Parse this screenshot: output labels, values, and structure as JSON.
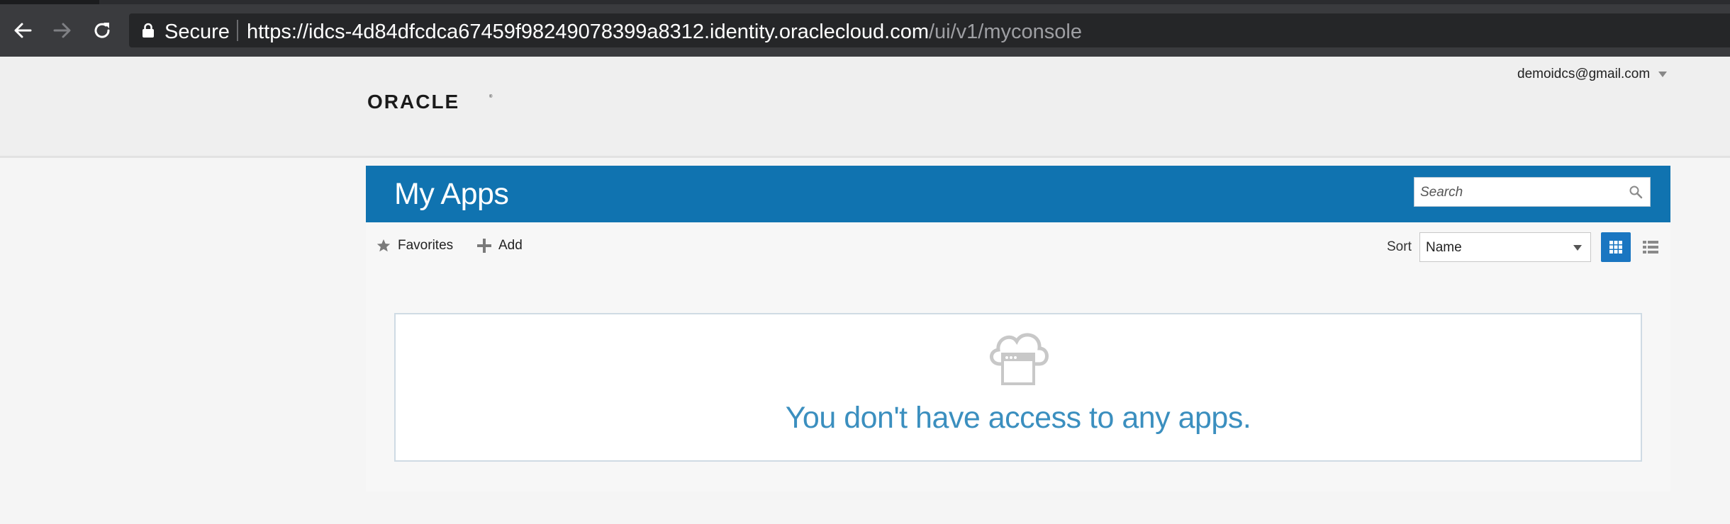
{
  "browser": {
    "back_icon": "arrow-left-icon",
    "forward_icon": "arrow-right-icon",
    "reload_icon": "reload-icon",
    "lock_icon": "lock-icon",
    "secure_label": "Secure",
    "url_host": "https://idcs-4d84dfcdca67459f98249078399a8312.identity.oraclecloud.com",
    "url_path": "/ui/v1/myconsole"
  },
  "header": {
    "logo_text": "ORACLE",
    "user_email": "demoidcs@gmail.com"
  },
  "apps": {
    "title": "My Apps",
    "search_placeholder": "Search",
    "favorites_label": "Favorites",
    "add_label": "Add",
    "sort_label": "Sort",
    "sort_value": "Name",
    "empty_message": "You don't have access to any apps."
  },
  "colors": {
    "banner": "#1073b0",
    "accent": "#1a76c1",
    "empty_text": "#3b8fbf"
  }
}
